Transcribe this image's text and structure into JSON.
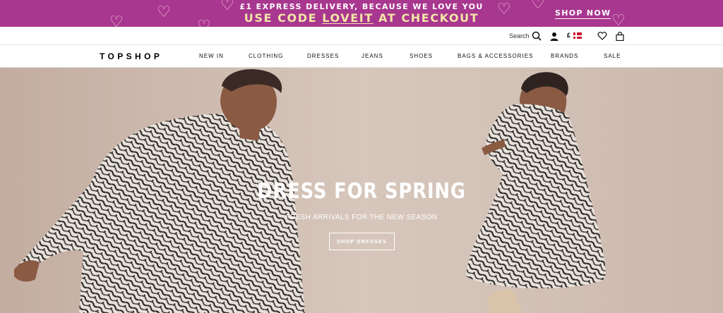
{
  "promo": {
    "line1": "£1 EXPRESS DELIVERY, BECAUSE WE LOVE YOU",
    "line2_prefix": "USE CODE ",
    "line2_code": "LOVEIT",
    "line2_suffix": " AT CHECKOUT",
    "shop_now": "SHOP NOW",
    "background": "#a8378f",
    "accent": "#f3e6a6"
  },
  "utility": {
    "search_label": "Search",
    "currency": "£",
    "icons": [
      "search-icon",
      "account-icon",
      "denmark-flag-icon",
      "wishlist-heart-icon",
      "bag-icon"
    ]
  },
  "nav": {
    "logo": "TOPSHOP",
    "items": [
      "NEW IN",
      "CLOTHING",
      "DRESSES",
      "JEANS",
      "SHOES",
      "BAGS & ACCESSORIES",
      "BRANDS",
      "SALE"
    ]
  },
  "hero": {
    "title": "DRESS FOR SPRING",
    "subtitle": "FRESH ARRIVALS FOR THE NEW SEASON",
    "cta": "SHOP DRESSES"
  }
}
